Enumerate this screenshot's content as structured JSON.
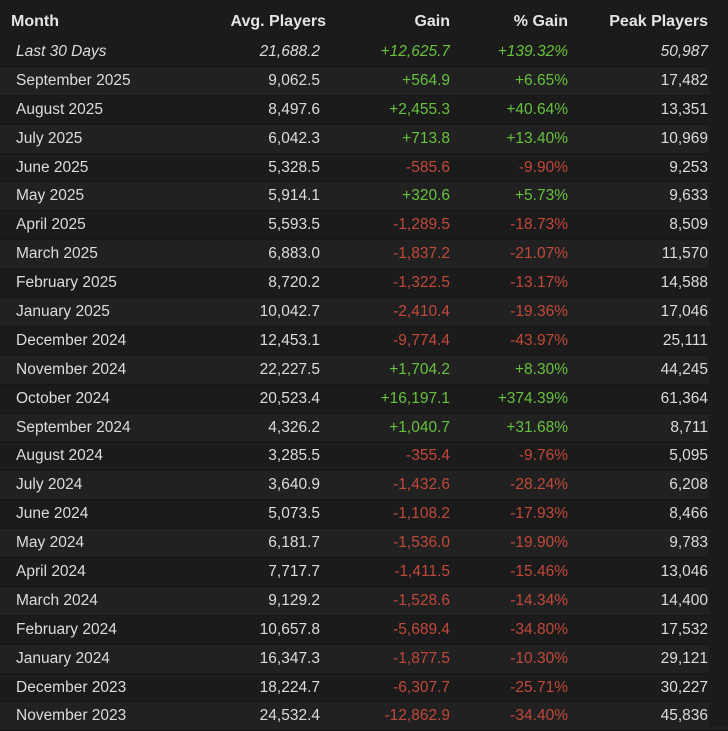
{
  "headers": {
    "month": "Month",
    "avg_players": "Avg. Players",
    "gain": "Gain",
    "pct_gain": "% Gain",
    "peak_players": "Peak Players"
  },
  "colors": {
    "positive": "#67c13c",
    "negative": "#c1493a",
    "background": "#1b1b1b",
    "row_alt": "#212121"
  },
  "rows": [
    {
      "month": "Last 30 Days",
      "avg": "21,688.2",
      "gain": "+12,625.7",
      "pct": "+139.32%",
      "peak": "50,987"
    },
    {
      "month": "September 2025",
      "avg": "9,062.5",
      "gain": "+564.9",
      "pct": "+6.65%",
      "peak": "17,482"
    },
    {
      "month": "August 2025",
      "avg": "8,497.6",
      "gain": "+2,455.3",
      "pct": "+40.64%",
      "peak": "13,351"
    },
    {
      "month": "July 2025",
      "avg": "6,042.3",
      "gain": "+713.8",
      "pct": "+13.40%",
      "peak": "10,969"
    },
    {
      "month": "June 2025",
      "avg": "5,328.5",
      "gain": "-585.6",
      "pct": "-9.90%",
      "peak": "9,253"
    },
    {
      "month": "May 2025",
      "avg": "5,914.1",
      "gain": "+320.6",
      "pct": "+5.73%",
      "peak": "9,633"
    },
    {
      "month": "April 2025",
      "avg": "5,593.5",
      "gain": "-1,289.5",
      "pct": "-18.73%",
      "peak": "8,509"
    },
    {
      "month": "March 2025",
      "avg": "6,883.0",
      "gain": "-1,837.2",
      "pct": "-21.07%",
      "peak": "11,570"
    },
    {
      "month": "February 2025",
      "avg": "8,720.2",
      "gain": "-1,322.5",
      "pct": "-13.17%",
      "peak": "14,588"
    },
    {
      "month": "January 2025",
      "avg": "10,042.7",
      "gain": "-2,410.4",
      "pct": "-19.36%",
      "peak": "17,046"
    },
    {
      "month": "December 2024",
      "avg": "12,453.1",
      "gain": "-9,774.4",
      "pct": "-43.97%",
      "peak": "25,111"
    },
    {
      "month": "November 2024",
      "avg": "22,227.5",
      "gain": "+1,704.2",
      "pct": "+8.30%",
      "peak": "44,245"
    },
    {
      "month": "October 2024",
      "avg": "20,523.4",
      "gain": "+16,197.1",
      "pct": "+374.39%",
      "peak": "61,364"
    },
    {
      "month": "September 2024",
      "avg": "4,326.2",
      "gain": "+1,040.7",
      "pct": "+31.68%",
      "peak": "8,711"
    },
    {
      "month": "August 2024",
      "avg": "3,285.5",
      "gain": "-355.4",
      "pct": "-9.76%",
      "peak": "5,095"
    },
    {
      "month": "July 2024",
      "avg": "3,640.9",
      "gain": "-1,432.6",
      "pct": "-28.24%",
      "peak": "6,208"
    },
    {
      "month": "June 2024",
      "avg": "5,073.5",
      "gain": "-1,108.2",
      "pct": "-17.93%",
      "peak": "8,466"
    },
    {
      "month": "May 2024",
      "avg": "6,181.7",
      "gain": "-1,536.0",
      "pct": "-19.90%",
      "peak": "9,783"
    },
    {
      "month": "April 2024",
      "avg": "7,717.7",
      "gain": "-1,411.5",
      "pct": "-15.46%",
      "peak": "13,046"
    },
    {
      "month": "March 2024",
      "avg": "9,129.2",
      "gain": "-1,528.6",
      "pct": "-14.34%",
      "peak": "14,400"
    },
    {
      "month": "February 2024",
      "avg": "10,657.8",
      "gain": "-5,689.4",
      "pct": "-34.80%",
      "peak": "17,532"
    },
    {
      "month": "January 2024",
      "avg": "16,347.3",
      "gain": "-1,877.5",
      "pct": "-10.30%",
      "peak": "29,121"
    },
    {
      "month": "December 2023",
      "avg": "18,224.7",
      "gain": "-6,307.7",
      "pct": "-25.71%",
      "peak": "30,227"
    },
    {
      "month": "November 2023",
      "avg": "24,532.4",
      "gain": "-12,862.9",
      "pct": "-34.40%",
      "peak": "45,836"
    }
  ]
}
